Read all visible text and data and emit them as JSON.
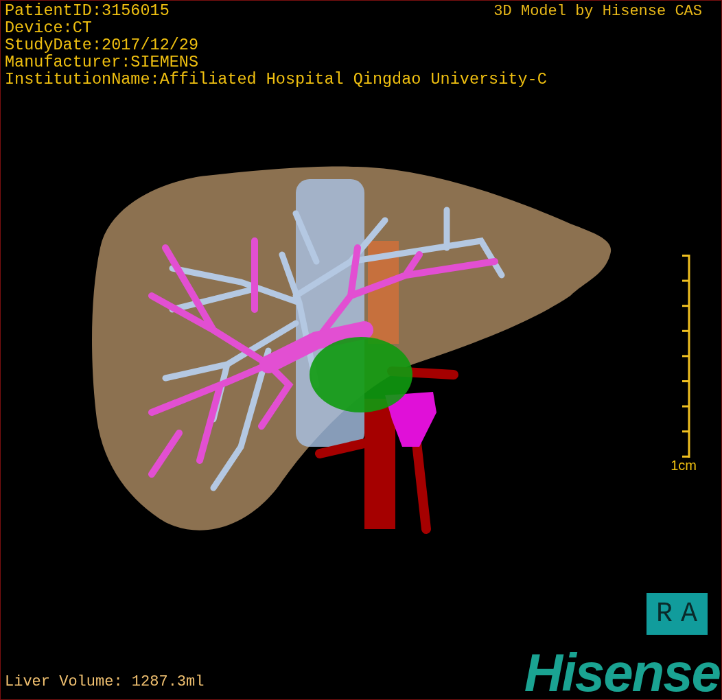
{
  "patient_info": [
    "PatientID:3156015",
    "Device:CT",
    "StudyDate:2017/12/29",
    "Manufacturer:SIEMENS",
    "InstitutionName:Affiliated Hospital Qingdao University-C"
  ],
  "title": "3D Model by Hisense CAS",
  "scale_bar": {
    "label": "1cm"
  },
  "orientation": "RA",
  "measurement": "Liver Volume: 1287.3ml",
  "logo": "Hisense"
}
